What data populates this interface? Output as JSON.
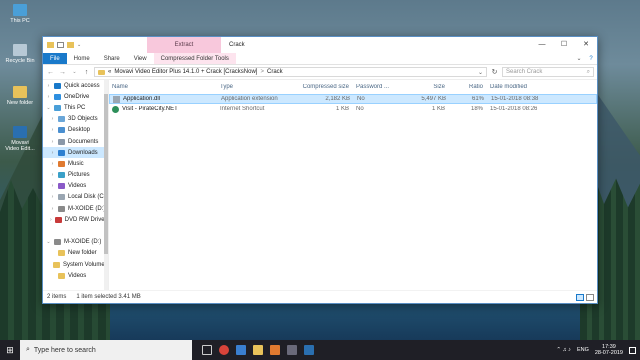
{
  "desktop": {
    "icons": [
      {
        "label": "This PC",
        "color": "#4a9fd8"
      },
      {
        "label": "Recycle Bin",
        "color": "#b7c9d6"
      },
      {
        "label": "New folder",
        "color": "#e8c25a"
      },
      {
        "label": "Movavi Video Edit...",
        "color": "#2a6fb0"
      }
    ]
  },
  "window": {
    "context_header": "Extract",
    "title": "Crack",
    "controls": {
      "minimize": "—",
      "maximize": "☐",
      "close": "✕"
    }
  },
  "ribbon": {
    "tabs": [
      "File",
      "Home",
      "Share",
      "View",
      "Compressed Folder Tools"
    ],
    "collapse": "⌄",
    "help": "?"
  },
  "address": {
    "path_prefix": "«",
    "segment1": "Movavi Video Editor Plus 14.1.0 + Crack [CracksNow]",
    "separator": ">",
    "segment2": "Crack",
    "dropdown": "⌄",
    "refresh": "↻",
    "search_placeholder": "Search Crack",
    "search_icon": "⌕"
  },
  "nav": {
    "back": "←",
    "forward": "→",
    "recent": "⌄",
    "up": "↑"
  },
  "navpane": {
    "items": [
      {
        "label": "Quick access",
        "chev": "›",
        "color": "#1979ca"
      },
      {
        "label": "OneDrive",
        "chev": "›",
        "color": "#2d8fe0"
      },
      {
        "label": "This PC",
        "chev": "⌄",
        "color": "#4a9fd8"
      },
      {
        "label": "3D Objects",
        "chev": "›",
        "color": "#6aa6d8"
      },
      {
        "label": "Desktop",
        "chev": "›",
        "color": "#4a8fd0"
      },
      {
        "label": "Documents",
        "chev": "›",
        "color": "#8a98a8"
      },
      {
        "label": "Downloads",
        "chev": "›",
        "color": "#2d7fd0"
      },
      {
        "label": "Music",
        "chev": "›",
        "color": "#e07a30"
      },
      {
        "label": "Pictures",
        "chev": "›",
        "color": "#3aa0c8"
      },
      {
        "label": "Videos",
        "chev": "›",
        "color": "#8a5ac8"
      },
      {
        "label": "Local Disk (C:)",
        "chev": "›",
        "color": "#9aa6b2"
      },
      {
        "label": "M-XOIDE (D:)",
        "chev": "›",
        "color": "#8a8a8a"
      },
      {
        "label": "DVD RW Drive (E:",
        "chev": "›",
        "color": "#c83a3a"
      },
      {
        "label": "",
        "chev": "",
        "color": "transparent"
      },
      {
        "label": "M-XOIDE (D:)",
        "chev": "⌄",
        "color": "#8a8a8a"
      },
      {
        "label": "New folder",
        "chev": "",
        "color": "#e8c25a"
      },
      {
        "label": "System Volume I",
        "chev": "",
        "color": "#e8c25a"
      },
      {
        "label": "Videos",
        "chev": "",
        "color": "#e8c25a"
      }
    ]
  },
  "columns": [
    "Name",
    "Type",
    "Compressed size",
    "Password ...",
    "Size",
    "Ratio",
    "Date modified"
  ],
  "files": [
    {
      "name": "Application.dll",
      "type": "Application extension",
      "csize": "2,182 KB",
      "pw": "No",
      "size": "5,497 KB",
      "ratio": "61%",
      "date": "15-01-2018 08:38",
      "icon_color": "#9aa6b2"
    },
    {
      "name": "Visit - PirateCity.NET",
      "type": "Internet Shortcut",
      "csize": "1 KB",
      "pw": "No",
      "size": "1 KB",
      "ratio": "18%",
      "date": "15-01-2018 08:26",
      "icon_color": "#2d8f5a"
    }
  ],
  "status": {
    "items": "2 items",
    "selected": "1 item selected  3.41 MB"
  },
  "taskbar": {
    "start": "⊞",
    "search_placeholder": "Type here to search",
    "search_icon": "⌕",
    "lang": "ENG",
    "time": "17:39",
    "date": "28-07-2019",
    "tray_icons": "⌃  ♫  ♪"
  }
}
